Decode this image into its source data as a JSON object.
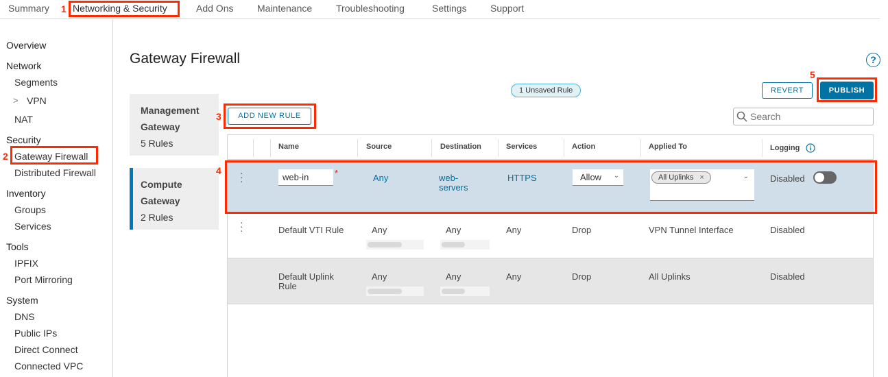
{
  "top_tabs": [
    "Summary",
    "Networking & Security",
    "Add Ons",
    "Maintenance",
    "Troubleshooting",
    "Settings",
    "Support"
  ],
  "sidebar": {
    "overview": "Overview",
    "network": "Network",
    "segments": "Segments",
    "vpn": "VPN",
    "nat": "NAT",
    "security": "Security",
    "gateway_firewall": "Gateway Firewall",
    "distributed_firewall": "Distributed Firewall",
    "inventory": "Inventory",
    "groups": "Groups",
    "services": "Services",
    "tools": "Tools",
    "ipfix": "IPFIX",
    "port_mirroring": "Port Mirroring",
    "system": "System",
    "dns": "DNS",
    "public_ips": "Public IPs",
    "direct_connect": "Direct Connect",
    "connected_vpc": "Connected VPC"
  },
  "callouts": [
    "1",
    "2",
    "3",
    "4",
    "5"
  ],
  "page": {
    "title": "Gateway Firewall",
    "help": "?"
  },
  "gateways": [
    {
      "line1": "Management",
      "line2": "Gateway",
      "rules": "5 Rules"
    },
    {
      "line1": "Compute",
      "line2": "Gateway",
      "rules": "2 Rules"
    }
  ],
  "unsaved_badge": "1 Unsaved Rule",
  "buttons": {
    "revert": "REVERT",
    "publish": "PUBLISH",
    "add_rule": "ADD NEW RULE"
  },
  "search": {
    "placeholder": "Search"
  },
  "columns": [
    "Name",
    "Source",
    "Destination",
    "Services",
    "Action",
    "Applied To",
    "Logging"
  ],
  "rows": [
    {
      "name": "web-in",
      "required_mark": "*",
      "source": "Any",
      "destination_1": "web-",
      "destination_2": "servers",
      "services": "HTTPS",
      "action": "Allow",
      "applied_to": "All Uplinks",
      "chip_close": "×",
      "logging": "Disabled"
    },
    {
      "name": "Default VTI Rule",
      "source": "Any",
      "destination": "Any",
      "services": "Any",
      "action": "Drop",
      "applied_to": "VPN Tunnel Interface",
      "logging": "Disabled"
    },
    {
      "name_1": "Default Uplink",
      "name_2": "Rule",
      "source": "Any",
      "destination": "Any",
      "services": "Any",
      "action": "Drop",
      "applied_to": "All Uplinks",
      "logging": "Disabled"
    }
  ],
  "colors": {
    "accent": "#0072a3",
    "callout": "#ff2a00",
    "selected_row": "#cfdee8",
    "disabled_row": "#e6e6e6"
  }
}
